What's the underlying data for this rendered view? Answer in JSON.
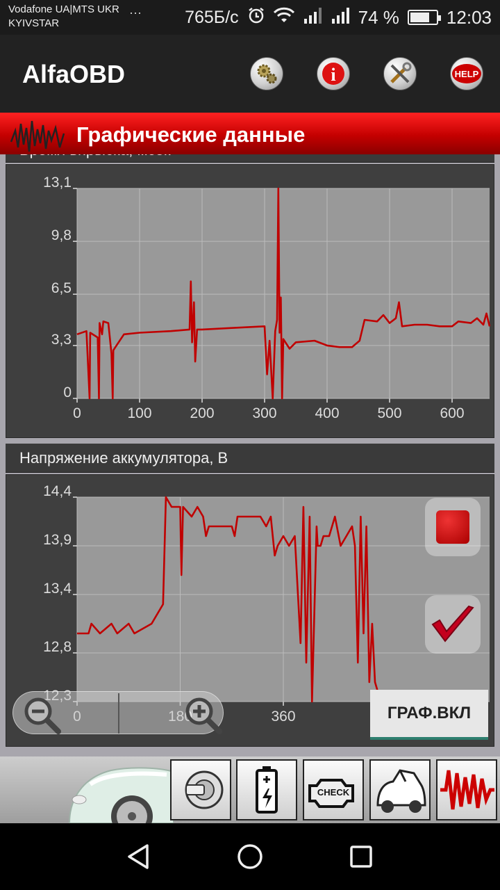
{
  "status_bar": {
    "carrier_line1": "Vodafone UA|MTS UKR",
    "carrier_line2": "KYIVSTAR",
    "more": "···",
    "speed": "765Б/с",
    "battery_percent": "74 %",
    "battery_level": 0.74,
    "time": "12:03"
  },
  "app_bar": {
    "title": "AlfaOBD",
    "actions": [
      {
        "name": "settings-gears-icon"
      },
      {
        "name": "info-icon",
        "label": "i"
      },
      {
        "name": "tools-icon"
      },
      {
        "name": "help-icon",
        "label": "HELP"
      }
    ]
  },
  "banner": {
    "title": "Графические данные"
  },
  "colors": {
    "line": "#c00000",
    "plot_bg": "#999999",
    "grid": "#bcbcbc",
    "panel": "#3f3f3f",
    "banner": "#cc0000"
  },
  "panel1": {
    "title": "Время впрыска, мсек"
  },
  "panel2": {
    "title": "Напряжение аккумулятора, В"
  },
  "chart_data": [
    {
      "type": "line",
      "title": "Время впрыска, мсек",
      "xlim": [
        0,
        660
      ],
      "ylim": [
        0,
        13.1
      ],
      "x_ticks": [
        "0",
        "100",
        "200",
        "300",
        "400",
        "500",
        "600"
      ],
      "y_ticks": [
        "0",
        "3,3",
        "6,5",
        "9,8",
        "13,1"
      ],
      "grid": true,
      "series": [
        {
          "values": [
            [
              0,
              4.0
            ],
            [
              15,
              4.2
            ],
            [
              20,
              0.0
            ],
            [
              21,
              4.1
            ],
            [
              33,
              3.8
            ],
            [
              35,
              0.0
            ],
            [
              36,
              4.7
            ],
            [
              40,
              4.0
            ],
            [
              42,
              4.8
            ],
            [
              50,
              4.7
            ],
            [
              55,
              2.8
            ],
            [
              57,
              0.0
            ],
            [
              58,
              3.0
            ],
            [
              63,
              3.3
            ],
            [
              75,
              4.0
            ],
            [
              100,
              4.1
            ],
            [
              150,
              4.2
            ],
            [
              180,
              4.3
            ],
            [
              182,
              7.3
            ],
            [
              184,
              3.5
            ],
            [
              187,
              6.0
            ],
            [
              189,
              2.3
            ],
            [
              192,
              4.3
            ],
            [
              200,
              4.3
            ],
            [
              250,
              4.4
            ],
            [
              300,
              4.5
            ],
            [
              304,
              1.5
            ],
            [
              308,
              3.6
            ],
            [
              313,
              0.0
            ],
            [
              317,
              4.2
            ],
            [
              320,
              4.9
            ],
            [
              322,
              13.1
            ],
            [
              324,
              4.1
            ],
            [
              326,
              6.3
            ],
            [
              328,
              0.0
            ],
            [
              330,
              3.7
            ],
            [
              340,
              3.1
            ],
            [
              350,
              3.5
            ],
            [
              380,
              3.6
            ],
            [
              400,
              3.3
            ],
            [
              420,
              3.2
            ],
            [
              440,
              3.2
            ],
            [
              452,
              3.6
            ],
            [
              460,
              4.9
            ],
            [
              480,
              4.8
            ],
            [
              490,
              5.2
            ],
            [
              500,
              4.7
            ],
            [
              510,
              5.0
            ],
            [
              515,
              6.0
            ],
            [
              520,
              4.5
            ],
            [
              540,
              4.6
            ],
            [
              560,
              4.6
            ],
            [
              580,
              4.5
            ],
            [
              600,
              4.5
            ],
            [
              610,
              4.8
            ],
            [
              630,
              4.7
            ],
            [
              640,
              5.0
            ],
            [
              650,
              4.6
            ],
            [
              655,
              5.3
            ],
            [
              660,
              4.5
            ]
          ]
        }
      ]
    },
    {
      "type": "line",
      "title": "Напряжение аккумулятора, В",
      "xlim": [
        0,
        720
      ],
      "ylim": [
        12.3,
        14.4
      ],
      "x_ticks": [
        "0",
        "180",
        "360"
      ],
      "y_ticks": [
        "12,3",
        "12,8",
        "13,4",
        "13,9",
        "14,4"
      ],
      "grid": true,
      "series": [
        {
          "values": [
            [
              0,
              13.0
            ],
            [
              20,
              13.0
            ],
            [
              25,
              13.1
            ],
            [
              40,
              13.0
            ],
            [
              60,
              13.1
            ],
            [
              70,
              13.0
            ],
            [
              90,
              13.1
            ],
            [
              100,
              13.0
            ],
            [
              130,
              13.1
            ],
            [
              150,
              13.3
            ],
            [
              155,
              14.4
            ],
            [
              165,
              14.3
            ],
            [
              180,
              14.3
            ],
            [
              182,
              13.6
            ],
            [
              185,
              14.3
            ],
            [
              200,
              14.2
            ],
            [
              210,
              14.3
            ],
            [
              220,
              14.2
            ],
            [
              225,
              14.0
            ],
            [
              230,
              14.1
            ],
            [
              270,
              14.1
            ],
            [
              275,
              14.0
            ],
            [
              280,
              14.2
            ],
            [
              320,
              14.2
            ],
            [
              330,
              14.1
            ],
            [
              338,
              14.2
            ],
            [
              345,
              13.8
            ],
            [
              350,
              13.9
            ],
            [
              360,
              14.0
            ],
            [
              370,
              13.9
            ],
            [
              380,
              14.0
            ],
            [
              390,
              12.9
            ],
            [
              395,
              14.3
            ],
            [
              400,
              12.7
            ],
            [
              406,
              14.2
            ],
            [
              410,
              12.3
            ],
            [
              418,
              14.1
            ],
            [
              420,
              13.9
            ],
            [
              425,
              13.9
            ],
            [
              430,
              14.0
            ],
            [
              440,
              14.0
            ],
            [
              450,
              14.2
            ],
            [
              460,
              13.9
            ],
            [
              470,
              14.0
            ],
            [
              480,
              14.1
            ],
            [
              485,
              13.9
            ],
            [
              490,
              12.7
            ],
            [
              495,
              14.2
            ],
            [
              500,
              13.0
            ],
            [
              505,
              14.1
            ],
            [
              510,
              12.5
            ],
            [
              515,
              13.1
            ],
            [
              520,
              12.5
            ],
            [
              525,
              12.4
            ]
          ]
        }
      ]
    }
  ],
  "zoom_out_icon": "zoom-out-icon",
  "zoom_in_icon": "zoom-in-icon",
  "stop_button": {
    "name": "stop-icon"
  },
  "check_button": {
    "name": "checkmark-icon"
  },
  "graph_button": {
    "label": "ГРАФ.ВКЛ"
  },
  "toolbar": {
    "buttons": [
      {
        "name": "ignition-key-icon"
      },
      {
        "name": "battery-icon"
      },
      {
        "name": "check-engine-icon",
        "label": "CHECK"
      },
      {
        "name": "car-service-icon"
      },
      {
        "name": "graph-waveform-icon"
      }
    ]
  }
}
